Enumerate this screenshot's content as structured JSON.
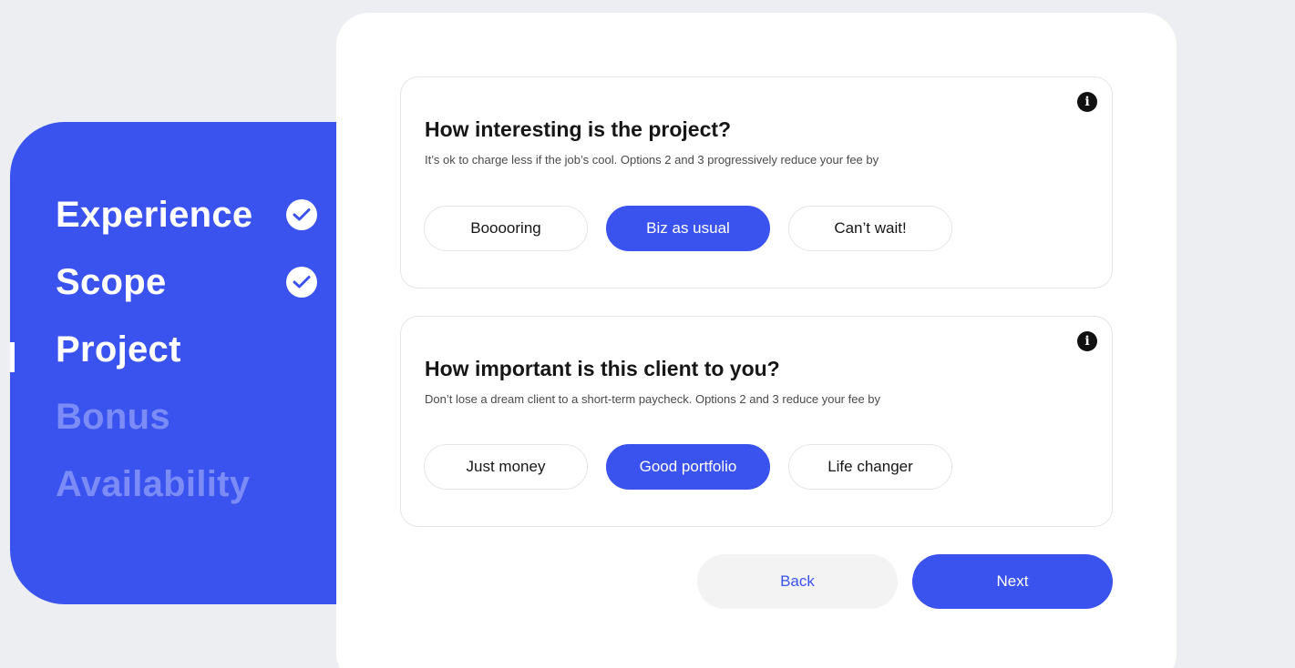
{
  "sidebar": {
    "steps": [
      {
        "label": "Experience",
        "state": "done"
      },
      {
        "label": "Scope",
        "state": "done"
      },
      {
        "label": "Project",
        "state": "current"
      },
      {
        "label": "Bonus",
        "state": "todo"
      },
      {
        "label": "Availability",
        "state": "todo"
      }
    ]
  },
  "questions": [
    {
      "title": "How interesting is the project?",
      "subtitle": "It’s ok to charge less if the job’s cool. Options 2 and 3 progressively reduce your fee by",
      "options": [
        "Booooring",
        "Biz as usual",
        "Can’t wait!"
      ],
      "selected": "Biz as usual"
    },
    {
      "title": "How important is this client to you?",
      "subtitle": "Don’t lose a dream client to a short-term paycheck. Options 2 and 3 reduce your fee by",
      "options": [
        "Just money",
        "Good portfolio",
        "Life changer"
      ],
      "selected": "Good portfolio"
    }
  ],
  "actions": {
    "back_label": "Back",
    "next_label": "Next"
  },
  "colors": {
    "accent": "#3b53ee",
    "background": "#eceef2",
    "inactive_step": "#7b8cf7"
  },
  "icons": {
    "done": "check-circle-icon",
    "info": "info-icon"
  }
}
